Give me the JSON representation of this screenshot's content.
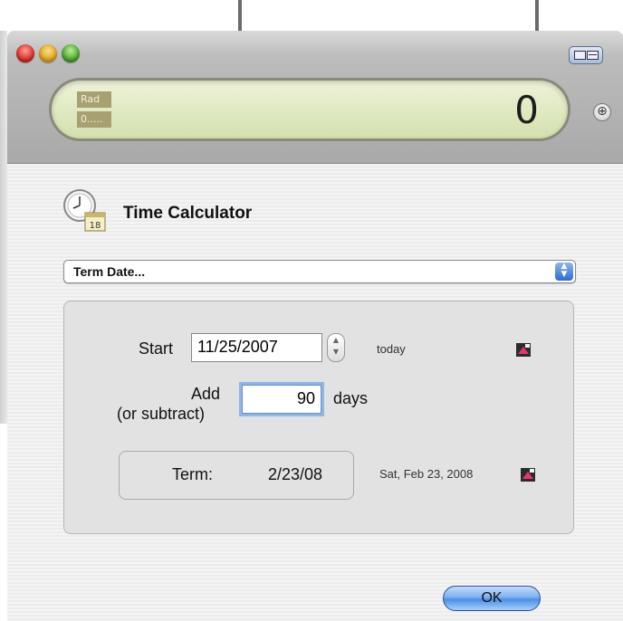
{
  "calculator": {
    "mode_badge": "Rad",
    "precision_badge": "0.....",
    "display_value": "0"
  },
  "panel": {
    "title": "Time Calculator",
    "function_select": "Term Date...",
    "start_label": "Start",
    "start_value": "11/25/2007",
    "start_hint": "today",
    "add_label": "Add",
    "subtract_label": "(or subtract)",
    "add_value": "90",
    "days_label": "days",
    "term_label": "Term:",
    "term_value": "2/23/08",
    "term_long": "Sat, Feb 23, 2008",
    "ok_label": "OK"
  },
  "icons": {
    "clock_calendar_day": "18"
  },
  "colors": {
    "lcd_background": "#dfe8c0",
    "ok_button": "#6fa6ec",
    "focus_ring": "#8fb4e8"
  }
}
